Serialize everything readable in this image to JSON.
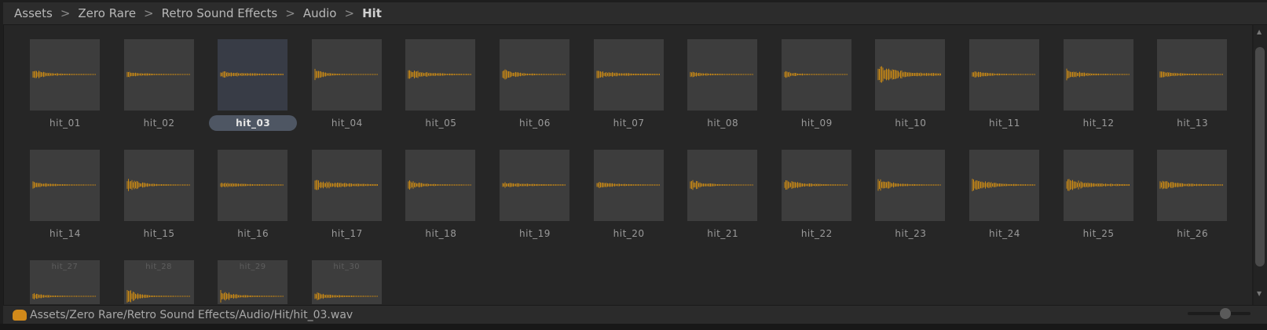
{
  "breadcrumb": [
    "Assets",
    "Zero Rare",
    "Retro Sound Effects",
    "Audio",
    "Hit"
  ],
  "breadcrumb_separator": ">",
  "selected": "hit_03",
  "files": [
    "hit_01",
    "hit_02",
    "hit_03",
    "hit_04",
    "hit_05",
    "hit_06",
    "hit_07",
    "hit_08",
    "hit_09",
    "hit_10",
    "hit_11",
    "hit_12",
    "hit_13",
    "hit_14",
    "hit_15",
    "hit_16",
    "hit_17",
    "hit_18",
    "hit_19",
    "hit_20",
    "hit_21",
    "hit_22",
    "hit_23",
    "hit_24",
    "hit_25",
    "hit_26",
    "hit_27",
    "hit_28",
    "hit_29",
    "hit_30"
  ],
  "footer": {
    "path": "Assets/Zero Rare/Retro Sound Effects/Audio/Hit/hit_03.wav",
    "icon": "audio-file-icon"
  },
  "zoom_slider": {
    "value": 0.6
  },
  "colors": {
    "waveform": "#e0960f",
    "selection": "#4e5663"
  }
}
